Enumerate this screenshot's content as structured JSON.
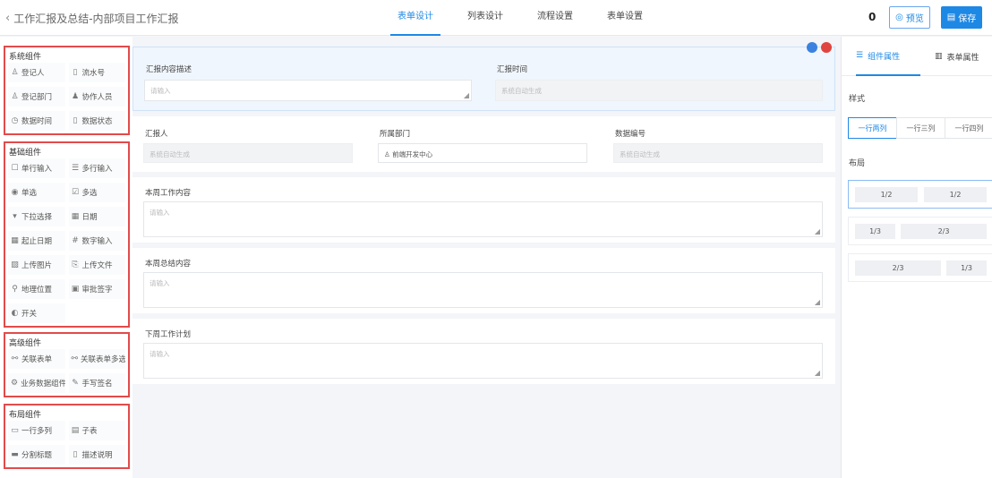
{
  "header": {
    "title": "工作汇报及总结-内部项目工作汇报",
    "tabs": [
      "表单设计",
      "列表设计",
      "流程设置",
      "表单设置"
    ],
    "count": "0",
    "preview_label": "预览",
    "save_label": "保存"
  },
  "left": {
    "groups": [
      {
        "title": "系统组件",
        "items": [
          {
            "icon": "user-icon",
            "glyph": "♙",
            "label": "登记人"
          },
          {
            "icon": "doc-icon",
            "glyph": "▯",
            "label": "流水号"
          },
          {
            "icon": "org-icon",
            "glyph": "♙",
            "label": "登记部门"
          },
          {
            "icon": "people-icon",
            "glyph": "♟",
            "label": "协作人员"
          },
          {
            "icon": "clock-icon",
            "glyph": "◷",
            "label": "数据时间"
          },
          {
            "icon": "doc-icon",
            "glyph": "▯",
            "label": "数据状态"
          }
        ]
      },
      {
        "title": "基础组件",
        "items": [
          {
            "icon": "single-line-icon",
            "glyph": "☐",
            "label": "单行输入"
          },
          {
            "icon": "multi-line-icon",
            "glyph": "☰",
            "label": "多行输入"
          },
          {
            "icon": "radio-icon",
            "glyph": "◉",
            "label": "单选"
          },
          {
            "icon": "checkbox-icon",
            "glyph": "☑",
            "label": "多选"
          },
          {
            "icon": "dropdown-icon",
            "glyph": "▾",
            "label": "下拉选择"
          },
          {
            "icon": "date-icon",
            "glyph": "▦",
            "label": "日期"
          },
          {
            "icon": "date-range-icon",
            "glyph": "▦",
            "label": "起止日期"
          },
          {
            "icon": "number-icon",
            "glyph": "#",
            "label": "数字输入"
          },
          {
            "icon": "image-upload-icon",
            "glyph": "▨",
            "label": "上传图片"
          },
          {
            "icon": "file-upload-icon",
            "glyph": "⎘",
            "label": "上传文件"
          },
          {
            "icon": "location-icon",
            "glyph": "⚲",
            "label": "地理位置"
          },
          {
            "icon": "lock-icon",
            "glyph": "▣",
            "label": "审批签字"
          },
          {
            "icon": "toggle-icon",
            "glyph": "◐",
            "label": "开关"
          }
        ]
      },
      {
        "title": "高级组件",
        "items": [
          {
            "icon": "link-icon",
            "glyph": "⚯",
            "label": "关联表单"
          },
          {
            "icon": "link-multi-icon",
            "glyph": "⚯",
            "label": "关联表单多选"
          },
          {
            "icon": "data-icon",
            "glyph": "⚙",
            "label": "业务数据组件"
          },
          {
            "icon": "signature-icon",
            "glyph": "✎",
            "label": "手写签名"
          }
        ]
      },
      {
        "title": "布局组件",
        "items": [
          {
            "icon": "row-layout-icon",
            "glyph": "▭",
            "label": "一行多列"
          },
          {
            "icon": "subtable-icon",
            "glyph": "▤",
            "label": "子表"
          },
          {
            "icon": "divider-icon",
            "glyph": "▬",
            "label": "分割标题"
          },
          {
            "icon": "description-icon",
            "glyph": "▯",
            "label": "描述说明"
          }
        ]
      }
    ]
  },
  "canvas": {
    "row1": {
      "field1": {
        "label": "汇报内容描述",
        "placeholder": "请输入"
      },
      "field2": {
        "label": "汇报时间",
        "placeholder": "系统自动生成"
      }
    },
    "row2": {
      "field1": {
        "label": "汇报人",
        "placeholder": "系统自动生成"
      },
      "field2": {
        "label": "所属部门",
        "value": "前端开发中心"
      },
      "field3": {
        "label": "数据编号",
        "placeholder": "系统自动生成"
      }
    },
    "row3": {
      "label": "本周工作内容",
      "placeholder": "请输入"
    },
    "row4": {
      "label": "本周总结内容",
      "placeholder": "请输入"
    },
    "row5": {
      "label": "下周工作计划",
      "placeholder": "请输入"
    },
    "colors": {
      "dot_blue": "#3b82e0",
      "dot_red": "#e0443e"
    }
  },
  "right": {
    "tabs": [
      "组件属性",
      "表单属性"
    ],
    "style_label": "样式",
    "style_options": [
      "一行两列",
      "一行三列",
      "一行四列"
    ],
    "layout_label": "布局",
    "layouts": [
      [
        "1/2",
        "1/2"
      ],
      [
        "1/3",
        "2/3"
      ],
      [
        "2/3",
        "1/3"
      ]
    ]
  }
}
